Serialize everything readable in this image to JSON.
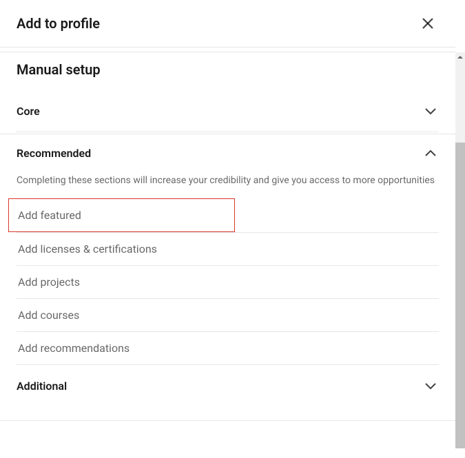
{
  "modal": {
    "title": "Add to profile",
    "body_title": "Manual setup"
  },
  "sections": {
    "core": {
      "title": "Core"
    },
    "recommended": {
      "title": "Recommended",
      "description": "Completing these sections will increase your credibility and give you access to more opportunities",
      "items": [
        "Add featured",
        "Add licenses & certifications",
        "Add projects",
        "Add courses",
        "Add recommendations"
      ]
    },
    "additional": {
      "title": "Additional"
    }
  }
}
